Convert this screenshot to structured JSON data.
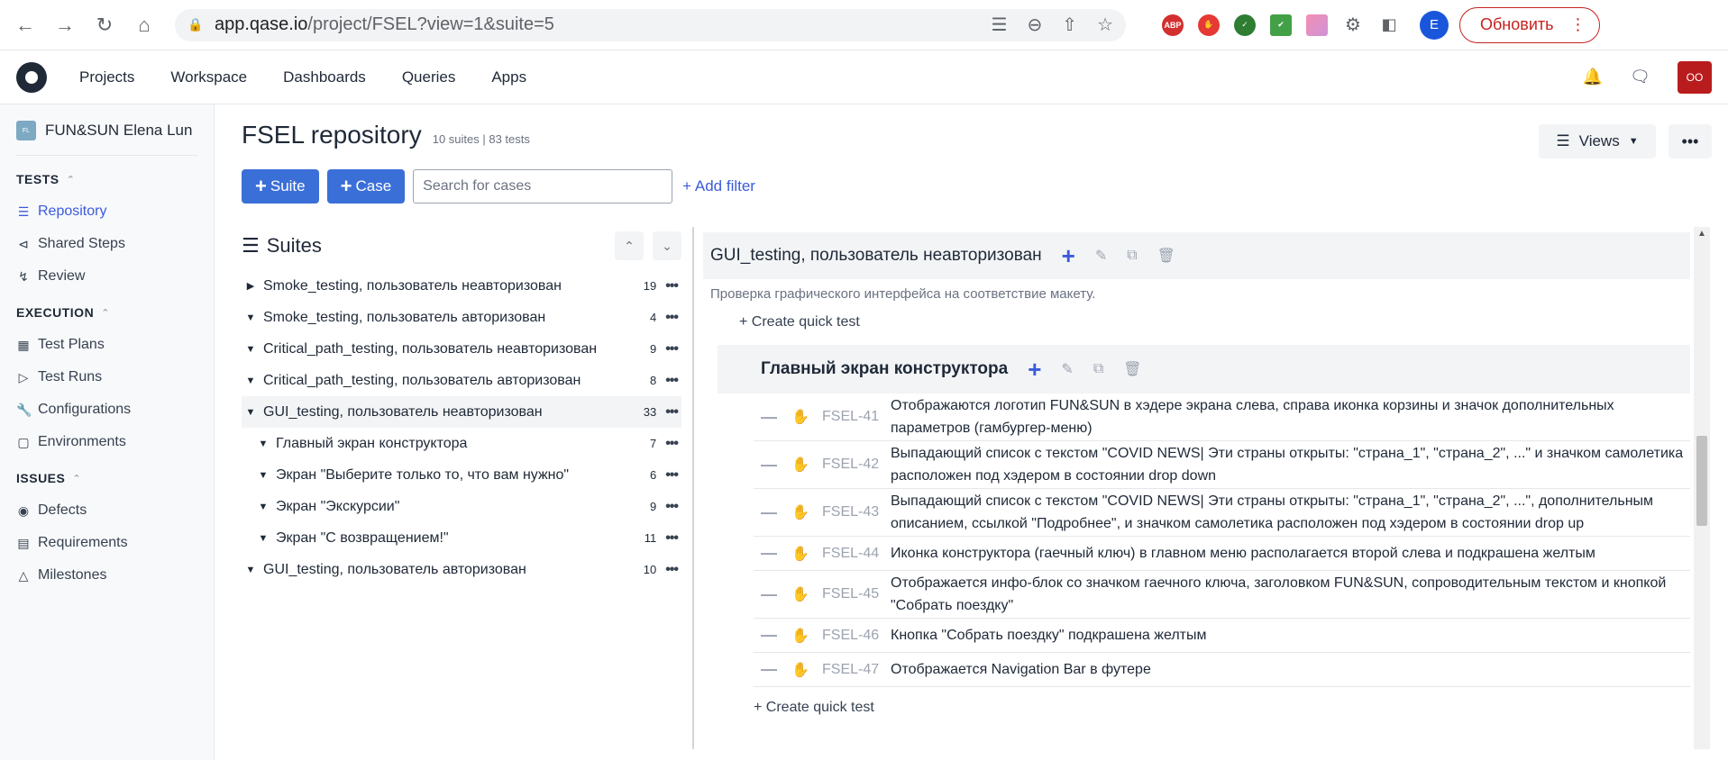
{
  "browser": {
    "url_host": "app.qase.io",
    "url_path": "/project/FSEL?view=1&suite=5",
    "update_label": "Обновить",
    "profile_initial": "E"
  },
  "app": {
    "nav": [
      "Projects",
      "Workspace",
      "Dashboards",
      "Queries",
      "Apps"
    ],
    "user_initials": "OO"
  },
  "sidebar": {
    "project_icon": "FL",
    "project_name": "FUN&SUN Elena Lun",
    "sections": [
      {
        "title": "TESTS",
        "items": [
          {
            "label": "Repository",
            "icon": "list-icon",
            "active": true
          },
          {
            "label": "Shared Steps",
            "icon": "share-icon"
          },
          {
            "label": "Review",
            "icon": "branch-icon"
          }
        ]
      },
      {
        "title": "EXECUTION",
        "items": [
          {
            "label": "Test Plans",
            "icon": "calendar-icon"
          },
          {
            "label": "Test Runs",
            "icon": "play-icon"
          },
          {
            "label": "Configurations",
            "icon": "wrench-icon"
          },
          {
            "label": "Environments",
            "icon": "cube-icon"
          }
        ]
      },
      {
        "title": "ISSUES",
        "items": [
          {
            "label": "Defects",
            "icon": "bug-icon"
          },
          {
            "label": "Requirements",
            "icon": "doc-icon"
          },
          {
            "label": "Milestones",
            "icon": "triangle-icon"
          }
        ]
      }
    ]
  },
  "main": {
    "title": "FSEL repository",
    "meta": "10 suites | 83 tests",
    "views_label": "Views",
    "suite_btn": "Suite",
    "case_btn": "Case",
    "search_placeholder": "Search for cases",
    "add_filter": "+ Add filter",
    "suites_title": "Suites"
  },
  "suites": [
    {
      "name": "Smoke_testing, пользователь неавторизован",
      "count": "19",
      "expanded": false,
      "child": false
    },
    {
      "name": "Smoke_testing, пользователь авторизован",
      "count": "4",
      "expanded": true,
      "child": false
    },
    {
      "name": "Critical_path_testing, пользователь неавторизован",
      "count": "9",
      "expanded": true,
      "child": false
    },
    {
      "name": "Critical_path_testing, пользователь авторизован",
      "count": "8",
      "expanded": true,
      "child": false
    },
    {
      "name": "GUI_testing, пользователь неавторизован",
      "count": "33",
      "expanded": true,
      "child": false,
      "selected": true
    },
    {
      "name": "Главный экран конструктора",
      "count": "7",
      "expanded": true,
      "child": true
    },
    {
      "name": "Экран \"Выберите только то, что вам нужно\"",
      "count": "6",
      "expanded": true,
      "child": true
    },
    {
      "name": "Экран \"Экскурсии\"",
      "count": "9",
      "expanded": true,
      "child": true
    },
    {
      "name": "Экран \"С возвращением!\"",
      "count": "11",
      "expanded": true,
      "child": true
    },
    {
      "name": "GUI_testing, пользователь авторизован",
      "count": "10",
      "expanded": true,
      "child": false
    }
  ],
  "cases_pane": {
    "suite_name": "GUI_testing, пользователь неавторизован",
    "suite_desc": "Проверка графического интерфейса на соответствие макету.",
    "quick_test": "+ Create quick test",
    "sub_suite_name": "Главный экран конструктора",
    "cases": [
      {
        "id": "FSEL-41",
        "title": "Отображаются логотип FUN&SUN в хэдере экрана слева, справа иконка корзины и значок дополнительных параметров (гамбургер-меню)"
      },
      {
        "id": "FSEL-42",
        "title": "Выпадающий список с текстом \"COVID NEWS| Эти страны открыты: \"страна_1\", \"страна_2\", ...\" и значком самолетика расположен под хэдером в состоянии drop down"
      },
      {
        "id": "FSEL-43",
        "title": "Выпадающий список с текстом \"COVID NEWS| Эти страны открыты: \"страна_1\", \"страна_2\", ...\", дополнительным описанием, ссылкой \"Подробнее\", и значком самолетика расположен под хэдером в состоянии drop up"
      },
      {
        "id": "FSEL-44",
        "title": "Иконка конструктора (гаечный ключ) в главном меню располагается второй слева и подкрашена желтым"
      },
      {
        "id": "FSEL-45",
        "title": "Отображается инфо-блок со значком гаечного ключа, заголовком FUN&SUN, сопроводительным текстом и кнопкой \"Собрать поездку\""
      },
      {
        "id": "FSEL-46",
        "title": "Кнопка \"Собрать поездку\" подкрашена желтым"
      },
      {
        "id": "FSEL-47",
        "title": "Отображается Navigation Bar в футере"
      }
    ],
    "quick_test_2": "+ Create quick test"
  }
}
